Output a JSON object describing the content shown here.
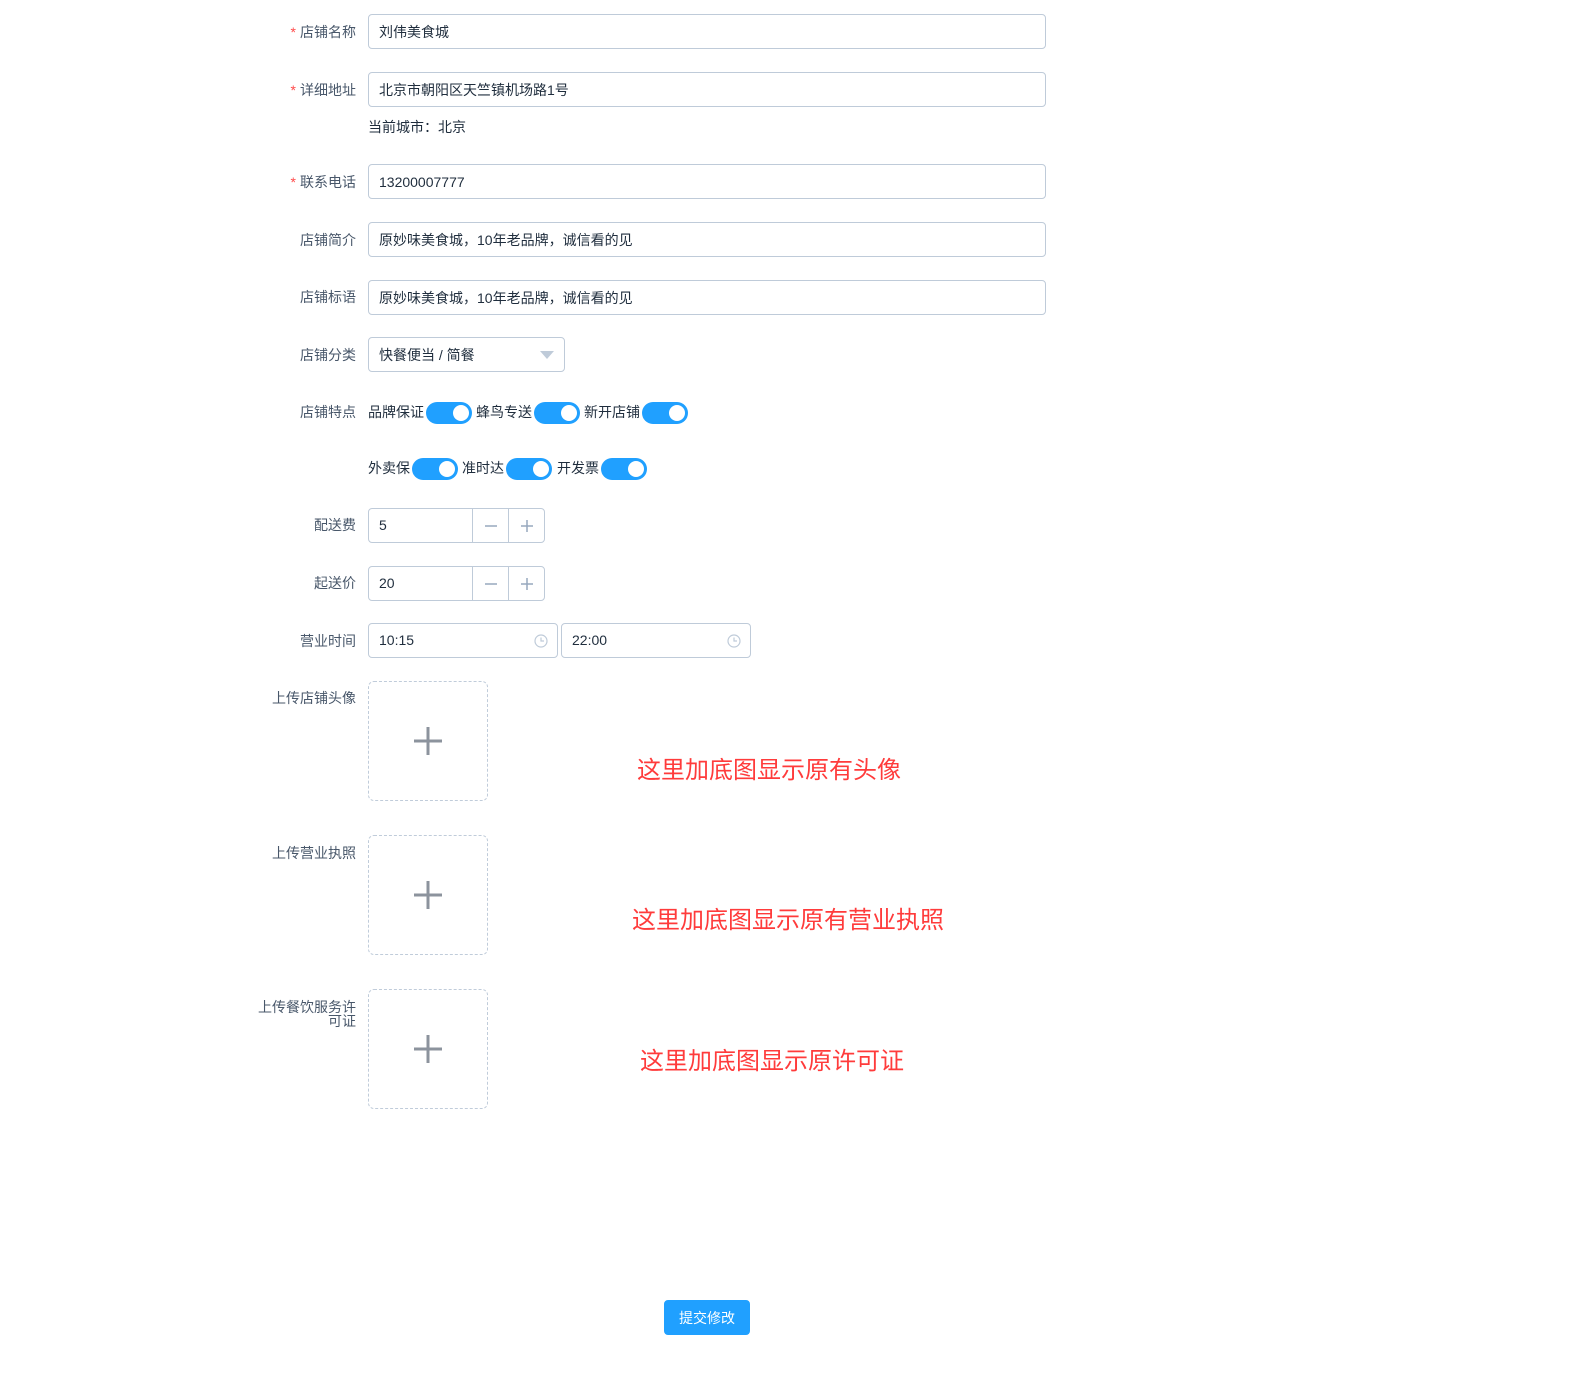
{
  "form": {
    "shop_name": {
      "label": "店铺名称",
      "required": true,
      "value": "刘伟美食城"
    },
    "address": {
      "label": "详细地址",
      "required": true,
      "value": "北京市朝阳区天竺镇机场路1号",
      "city_hint": "当前城市：北京"
    },
    "phone": {
      "label": "联系电话",
      "required": true,
      "value": "13200007777"
    },
    "intro": {
      "label": "店铺简介",
      "value": "原妙味美食城，10年老品牌，诚信看的见"
    },
    "slogan": {
      "label": "店铺标语",
      "value": "原妙味美食城，10年老品牌，诚信看的见"
    },
    "category": {
      "label": "店铺分类",
      "value": "快餐便当 / 简餐"
    },
    "features": {
      "label": "店铺特点",
      "items": [
        {
          "name": "品牌保证",
          "on": true
        },
        {
          "name": "蜂鸟专送",
          "on": true
        },
        {
          "name": "新开店铺",
          "on": true
        },
        {
          "name": "外卖保",
          "on": true
        },
        {
          "name": "准时达",
          "on": true
        },
        {
          "name": "开发票",
          "on": true
        }
      ]
    },
    "delivery_fee": {
      "label": "配送费",
      "value": "5"
    },
    "min_order": {
      "label": "起送价",
      "value": "20"
    },
    "hours": {
      "label": "营业时间",
      "start": "10:15",
      "end": "22:00"
    },
    "upload_avatar": {
      "label": "上传店铺头像",
      "note": "这里加底图显示原有头像"
    },
    "upload_license": {
      "label": "上传营业执照",
      "note": "这里加底图显示原有营业执照"
    },
    "upload_permit": {
      "label_line1": "上传餐饮服务许",
      "label_line2": "可证",
      "note": "这里加底图显示原许可证"
    },
    "submit_label": "提交修改"
  },
  "colors": {
    "primary": "#20a0ff",
    "required": "#ff4949",
    "note": "#ff3b3b",
    "border": "#bfcbd9"
  }
}
